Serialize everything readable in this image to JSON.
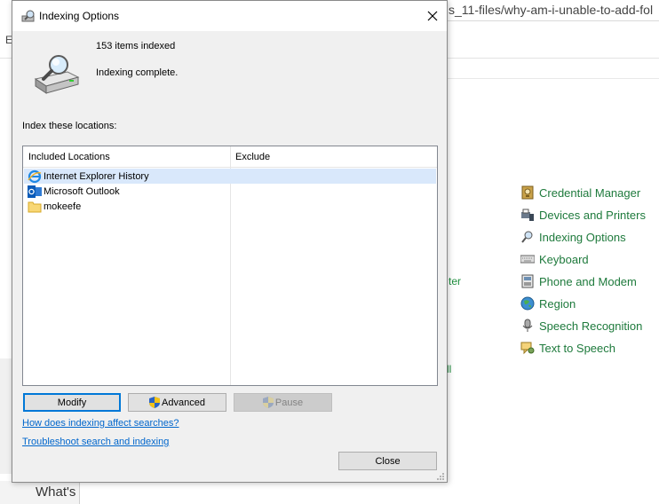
{
  "background": {
    "url_fragment": "s_11-files/why-am-i-unable-to-add-fol",
    "left_letter": "E",
    "fragment_er": "ter",
    "fragment_ll": "ll",
    "footer_text": "What's",
    "control_panel_items": [
      {
        "label": "Credential Manager",
        "icon": "credential-manager-icon"
      },
      {
        "label": "Devices and Printers",
        "icon": "printer-icon"
      },
      {
        "label": "Indexing Options",
        "icon": "indexing-icon"
      },
      {
        "label": "Keyboard",
        "icon": "keyboard-icon"
      },
      {
        "label": "Phone and Modem",
        "icon": "phone-icon"
      },
      {
        "label": "Region",
        "icon": "globe-icon"
      },
      {
        "label": "Speech Recognition",
        "icon": "microphone-icon"
      },
      {
        "label": "Text to Speech",
        "icon": "speech-icon"
      }
    ]
  },
  "dialog": {
    "title": "Indexing Options",
    "items_indexed": "153 items indexed",
    "status": "Indexing complete.",
    "locations_label": "Index these locations:",
    "columns": {
      "included": "Included Locations",
      "exclude": "Exclude"
    },
    "locations": [
      {
        "name": "Internet Explorer History",
        "icon": "internet-explorer-icon",
        "selected": true
      },
      {
        "name": "Microsoft Outlook",
        "icon": "outlook-icon",
        "selected": false
      },
      {
        "name": "mokeefe",
        "icon": "folder-icon",
        "selected": false
      }
    ],
    "buttons": {
      "modify": "Modify",
      "advanced": "Advanced",
      "pause": "Pause",
      "close": "Close"
    },
    "links": {
      "how_indexing": "How does indexing affect searches?",
      "troubleshoot": "Troubleshoot search and indexing"
    }
  },
  "colors": {
    "link": "#0066cc",
    "control_panel_link": "#1e7a3c",
    "selection": "#d9e8fb",
    "default_button_border": "#0078d7"
  }
}
